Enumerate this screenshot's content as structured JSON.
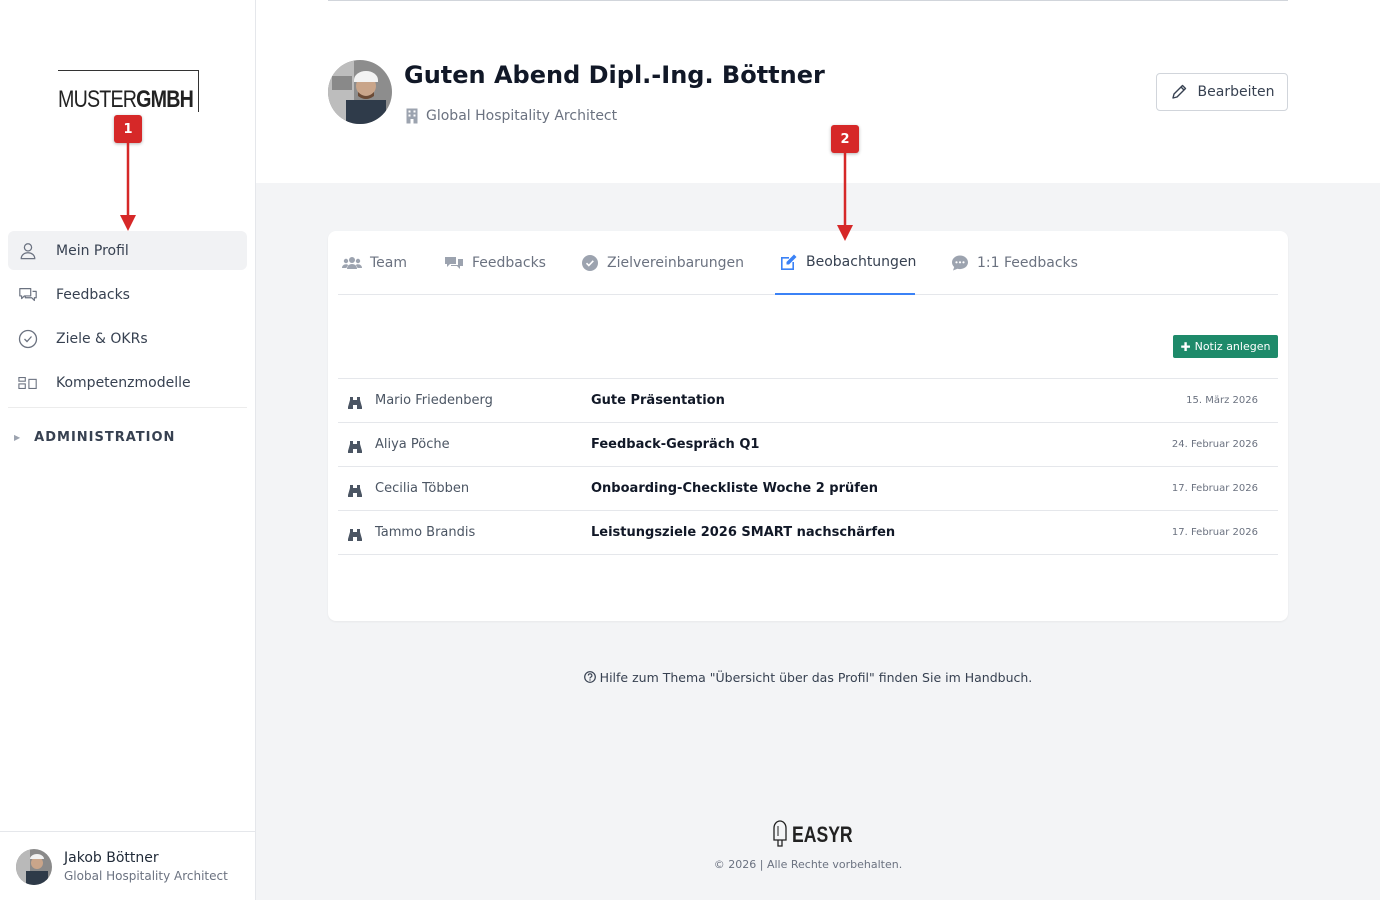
{
  "sidebar": {
    "logo": {
      "light": "MUSTER",
      "bold": "GMBH"
    },
    "nav": [
      {
        "label": "Mein Profil",
        "icon": "user-icon",
        "active": true
      },
      {
        "label": "Feedbacks",
        "icon": "chat-bubbles-icon",
        "active": false
      },
      {
        "label": "Ziele & OKRs",
        "icon": "check-circle-icon",
        "active": false
      },
      {
        "label": "Kompetenzmodelle",
        "icon": "blocks-icon",
        "active": false
      }
    ],
    "admin_label": "ADMINISTRATION",
    "user": {
      "name": "Jakob Böttner",
      "role": "Global Hospitality Architect"
    }
  },
  "header": {
    "greeting": "Guten Abend Dipl.-Ing. Böttner",
    "role": "Global Hospitality Architect",
    "edit_label": "Bearbeiten"
  },
  "tabs": [
    {
      "label": "Team",
      "icon": "users-icon"
    },
    {
      "label": "Feedbacks",
      "icon": "comments-icon"
    },
    {
      "label": "Zielvereinbarungen",
      "icon": "check-circle-icon"
    },
    {
      "label": "Beobachtungen",
      "icon": "edit-icon",
      "active": true
    },
    {
      "label": "1:1 Feedbacks",
      "icon": "comment-dots-icon"
    }
  ],
  "add_note_label": "Notiz anlegen",
  "observations": [
    {
      "author": "Mario Friedenberg",
      "title": "Gute Präsentation",
      "date": "15. März 2026"
    },
    {
      "author": "Aliya Pöche",
      "title": "Feedback-Gespräch Q1",
      "date": "24. Februar 2026"
    },
    {
      "author": "Cecilia Többen",
      "title": "Onboarding-Checkliste Woche 2 prüfen",
      "date": "17. Februar 2026"
    },
    {
      "author": "Tammo Brandis",
      "title": "Leistungsziele 2026 SMART nachschärfen",
      "date": "17. Februar 2026"
    }
  ],
  "help_text": "Hilfe zum Thema \"Übersicht über das Profil\" finden Sie im Handbuch.",
  "footer": {
    "brand": "EASYR",
    "copyright": "© 2026 | Alle Rechte vorbehalten."
  },
  "annotations": [
    {
      "label": "1"
    },
    {
      "label": "2"
    }
  ],
  "colors": {
    "accent": "#3b82f6",
    "button_green": "#1e8a6a",
    "badge_red": "#d62828"
  }
}
